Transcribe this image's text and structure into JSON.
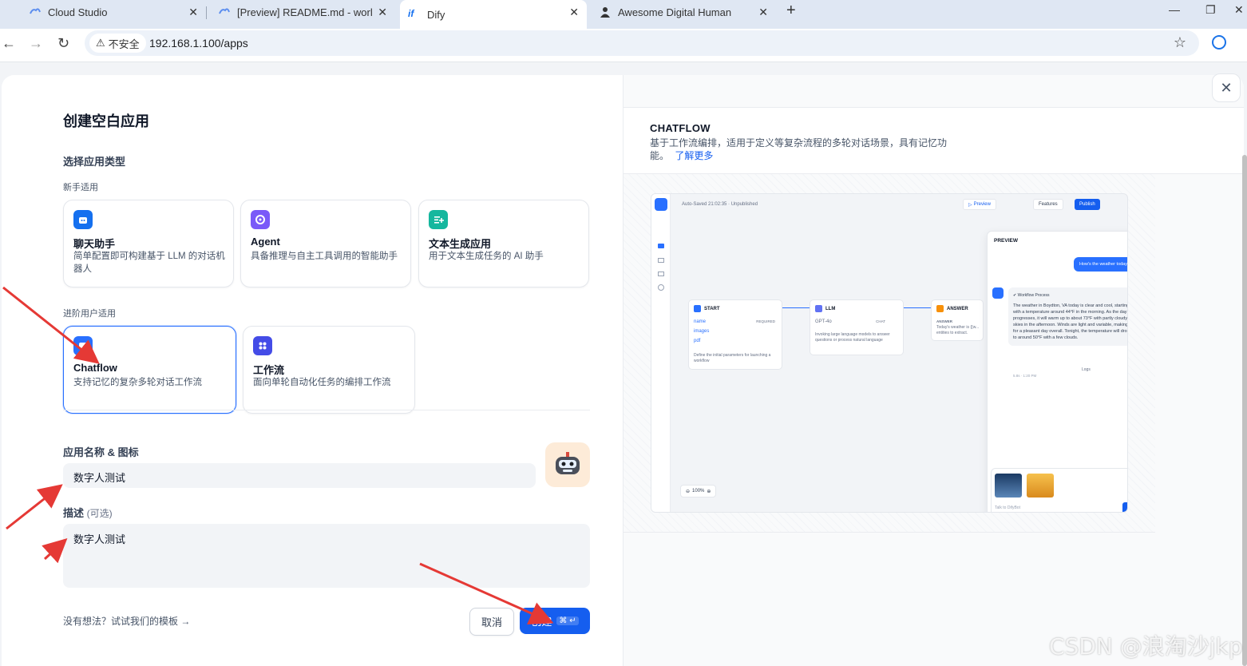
{
  "browser": {
    "tabs": [
      {
        "title": "Cloud Studio"
      },
      {
        "title": "[Preview] README.md - worl"
      },
      {
        "title": "Dify"
      },
      {
        "title": "Awesome Digital Human"
      }
    ],
    "security_label": "不安全",
    "url": "192.168.1.100/apps"
  },
  "dialog": {
    "title": "创建空白应用",
    "type_section": "选择应用类型",
    "beginner_label": "新手适用",
    "advanced_label": "进阶用户适用",
    "beginner_cards": [
      {
        "title": "聊天助手",
        "desc": "简单配置即可构建基于 LLM 的对话机器人"
      },
      {
        "title": "Agent",
        "desc": "具备推理与自主工具调用的智能助手"
      },
      {
        "title": "文本生成应用",
        "desc": "用于文本生成任务的 AI 助手"
      }
    ],
    "advanced_cards": [
      {
        "title": "Chatflow",
        "desc": "支持记忆的复杂多轮对话工作流"
      },
      {
        "title": "工作流",
        "desc": "面向单轮自动化任务的编排工作流"
      }
    ],
    "name_section": "应用名称 & 图标",
    "name_value": "数字人测试",
    "desc_section": "描述",
    "desc_optional": "(可选)",
    "desc_value": "数字人测试",
    "template_link": "没有想法？试试我们的模板 →",
    "cancel_label": "取消",
    "create_label": "创建",
    "create_kbd": "⌘ ↵"
  },
  "preview": {
    "title": "CHATFLOW",
    "desc": "基于工作流编排，适用于定义等复杂流程的多轮对话场景，具有记忆功能。",
    "learn_more": "了解更多",
    "mock": {
      "autosave": "Auto-Saved 21:02:35 · Unpublished",
      "preview_btn": "Preview",
      "features_btn": "Features",
      "publish_btn": "Publish",
      "node_start": "START",
      "start_vars": [
        "name",
        "images",
        "pdf"
      ],
      "start_required": "REQUIRED",
      "start_desc": "Define the initial parameters for launching a workflow",
      "node_llm": "LLM",
      "llm_model": "GPT-4o",
      "llm_mode": "CHAT",
      "llm_desc": "Invoking large language models to answer questions or process natural language",
      "node_answer": "ANSWER",
      "answer_label": "ANSWER",
      "answer_text": "Today's weather is {{w... entities to extract.",
      "pane_title": "PREVIEW",
      "user_msg": "How's the weather today",
      "workflow_process": "Workflow Process",
      "bot_msg": "The weather in Boydton, VA today is clear and cool, starting with a temperature around 44°F in the morning. As the day progresses, it will warm up to about 73°F with partly cloudy skies in the afternoon. Winds are light and variable, making for a pleasant day overall. Tonight, the temperature will drop to around 50°F with a few clouds.",
      "logs_label": "Logs",
      "msg_meta": "5.8s · 1:20 PM",
      "chat_placeholder": "Talk to DifyBot",
      "zoom": "100%"
    }
  },
  "watermark": "CSDN @浪淘沙jkp",
  "colors": {
    "primary": "#155eef",
    "chat_icon": "#1570ef",
    "agent_icon": "#7a5af8",
    "text_gen_icon": "#15b79e",
    "chatflow_icon": "#2970ff",
    "workflow_icon": "#444ce7",
    "annotation_arrow": "#e53935"
  }
}
